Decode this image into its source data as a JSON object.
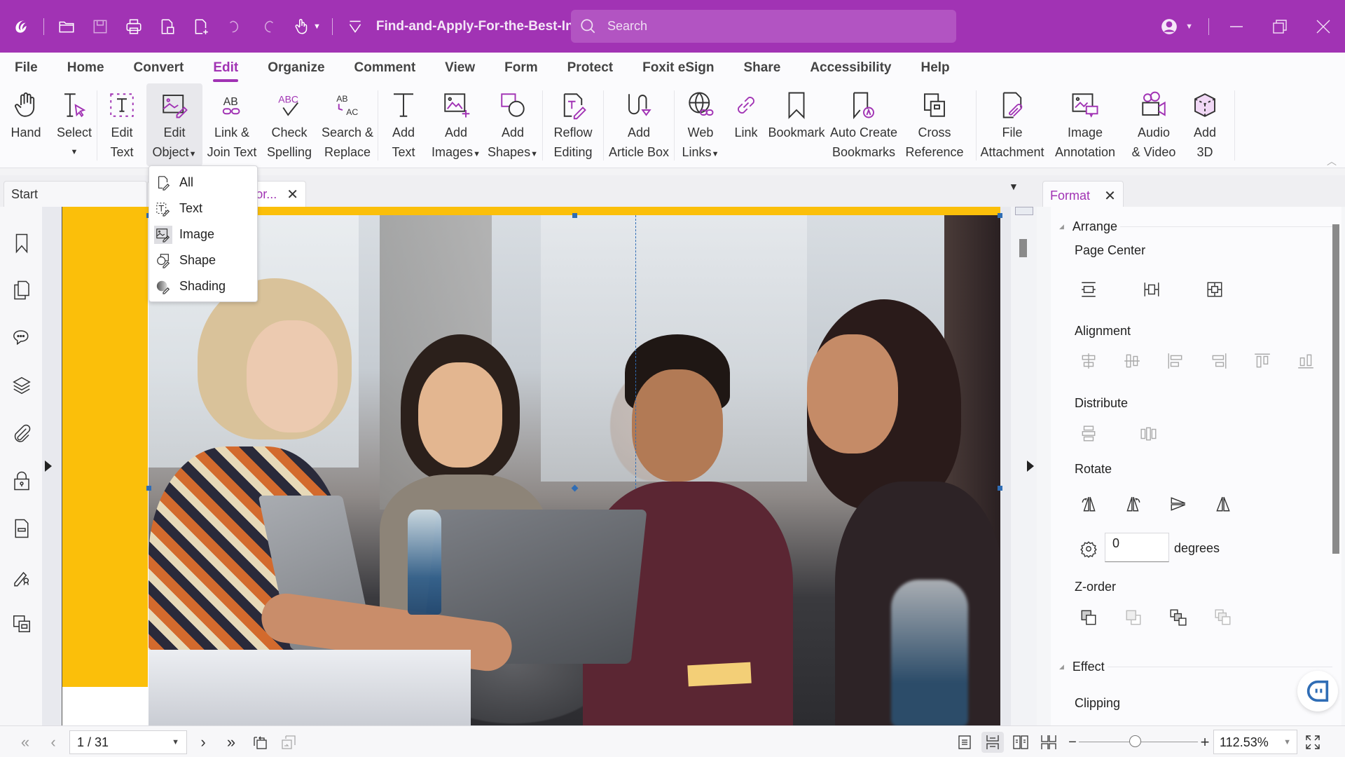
{
  "titlebar": {
    "file_name": "Find-and-Apply-For-the-Best-In...",
    "search_placeholder": "Search",
    "accent_color": "#a133b4"
  },
  "menu": {
    "items": [
      "File",
      "Home",
      "Convert",
      "Edit",
      "Organize",
      "Comment",
      "View",
      "Form",
      "Protect",
      "Foxit eSign",
      "Share",
      "Accessibility",
      "Help"
    ],
    "active": "Edit"
  },
  "ribbon": {
    "hand": "Hand",
    "select": "Select",
    "edit_text": [
      "Edit",
      "Text"
    ],
    "edit_object": [
      "Edit",
      "Object"
    ],
    "link_join": [
      "Link &",
      "Join Text"
    ],
    "check_spelling": [
      "Check",
      "Spelling"
    ],
    "search_replace": [
      "Search &",
      "Replace"
    ],
    "add_text": [
      "Add",
      "Text"
    ],
    "add_images": [
      "Add",
      "Images"
    ],
    "add_shapes": [
      "Add",
      "Shapes"
    ],
    "reflow": [
      "Reflow",
      "Editing"
    ],
    "article_box": [
      "Add",
      "Article Box"
    ],
    "web_links": [
      "Web",
      "Links"
    ],
    "link": "Link",
    "bookmark": "Bookmark",
    "auto_bookmarks": [
      "Auto Create",
      "Bookmarks"
    ],
    "cross_ref": [
      "Cross",
      "Reference"
    ],
    "file_attach": [
      "File",
      "Attachment"
    ],
    "image_annot": [
      "Image",
      "Annotation"
    ],
    "audio_video": [
      "Audio",
      "& Video"
    ],
    "add_3d": [
      "Add",
      "3D"
    ]
  },
  "edit_object_menu": {
    "items": [
      "All",
      "Text",
      "Image",
      "Shape",
      "Shading"
    ],
    "highlighted": "Image"
  },
  "tabs": {
    "start": "Start",
    "document": "For..."
  },
  "format_panel": {
    "tab_label": "Format",
    "arrange": "Arrange",
    "page_center": "Page Center",
    "alignment": "Alignment",
    "distribute": "Distribute",
    "rotate": "Rotate",
    "rotation_degrees": "0",
    "degrees_label": "degrees",
    "z_order": "Z-order",
    "effect": "Effect",
    "clipping": "Clipping"
  },
  "statusbar": {
    "page_indicator": "1 / 31",
    "zoom_value": "112.53%",
    "zoom_slider_fraction": 0.47
  }
}
